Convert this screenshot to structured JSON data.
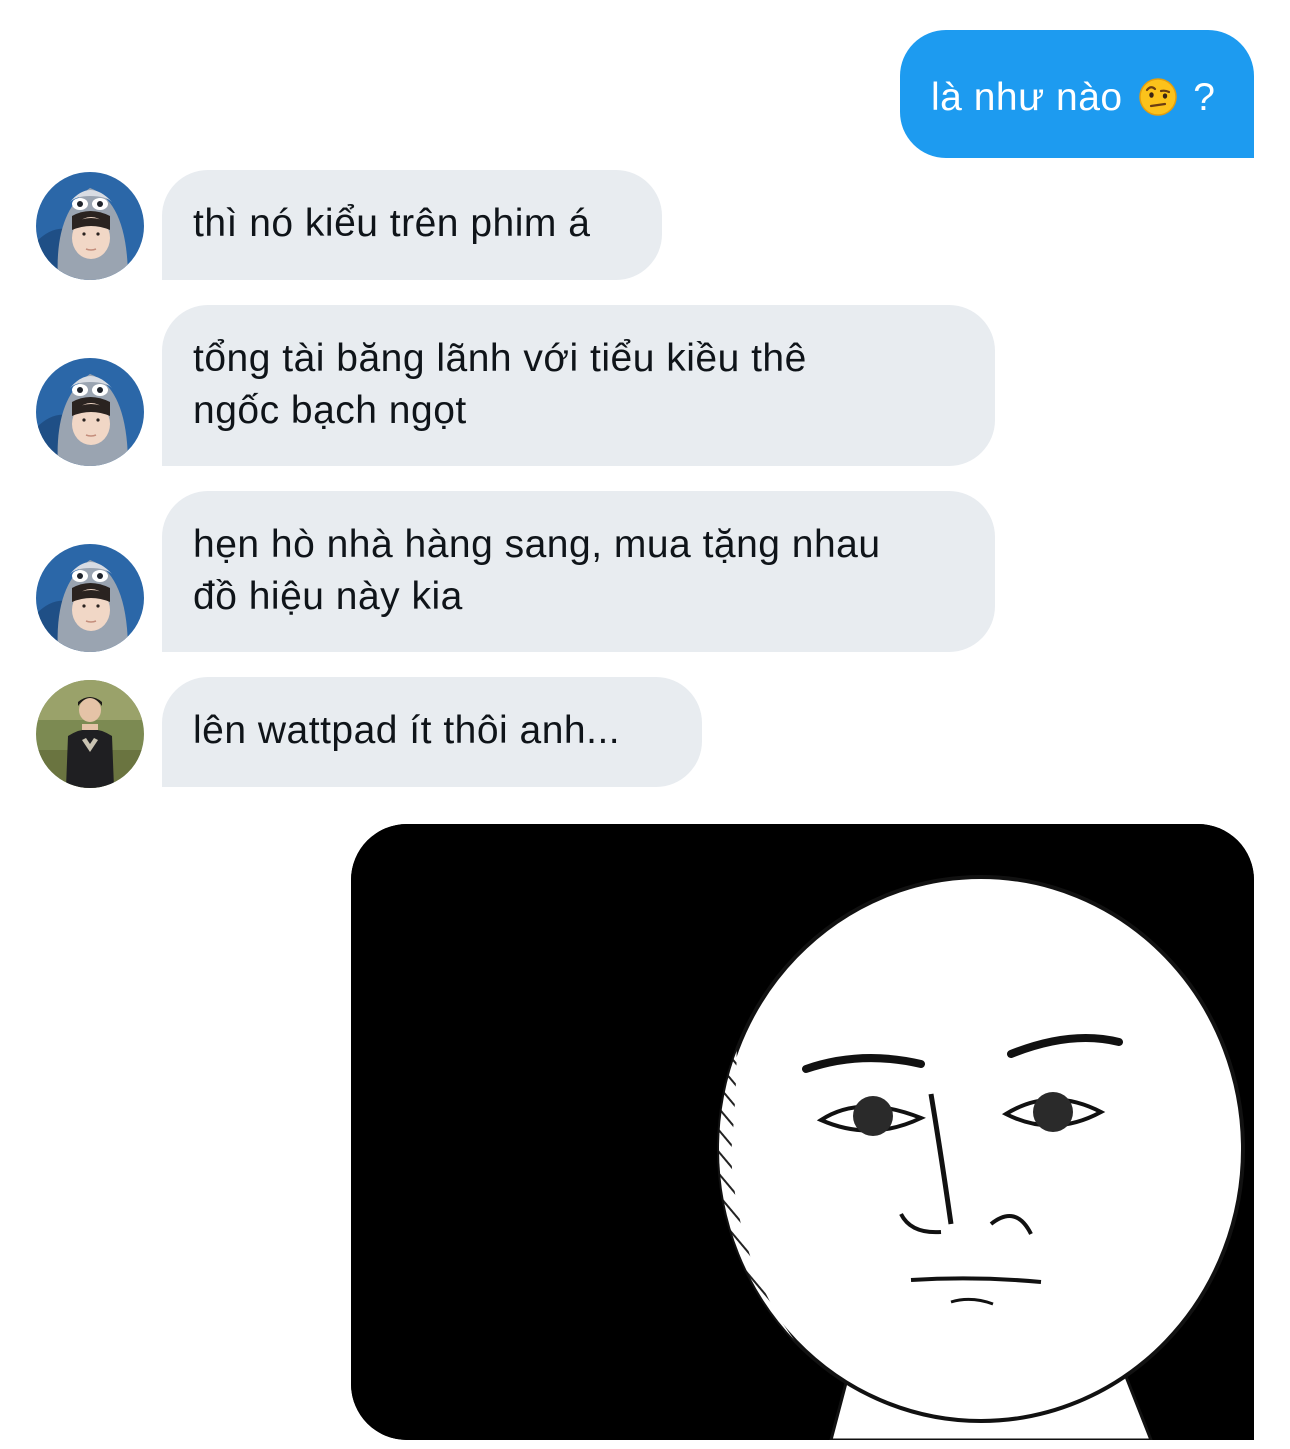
{
  "conversation": {
    "sent_message": {
      "text_before": "là như nào",
      "emoji": "face-with-raised-eyebrow-emoji",
      "text_after": "?"
    },
    "received_messages": [
      {
        "line1": "thì nó kiểu trên phim á",
        "line2": ""
      },
      {
        "line1": "tổng tài băng lãnh với tiểu kiều thê",
        "line2": "ngốc bạch ngọt"
      },
      {
        "line1": "hẹn hò nhà hàng sang, mua tặng nhau",
        "line2": "đồ hiệu này kia"
      },
      {
        "line1": "lên wattpad ít thôi anh...",
        "line2": ""
      }
    ],
    "sticker": {
      "icon": "meme-face-sticker"
    }
  },
  "colors": {
    "sent_bubble": "#1d9bf0",
    "received_bubble": "#e8ecf0",
    "text_dark": "#0f1419",
    "text_light": "#ffffff"
  }
}
